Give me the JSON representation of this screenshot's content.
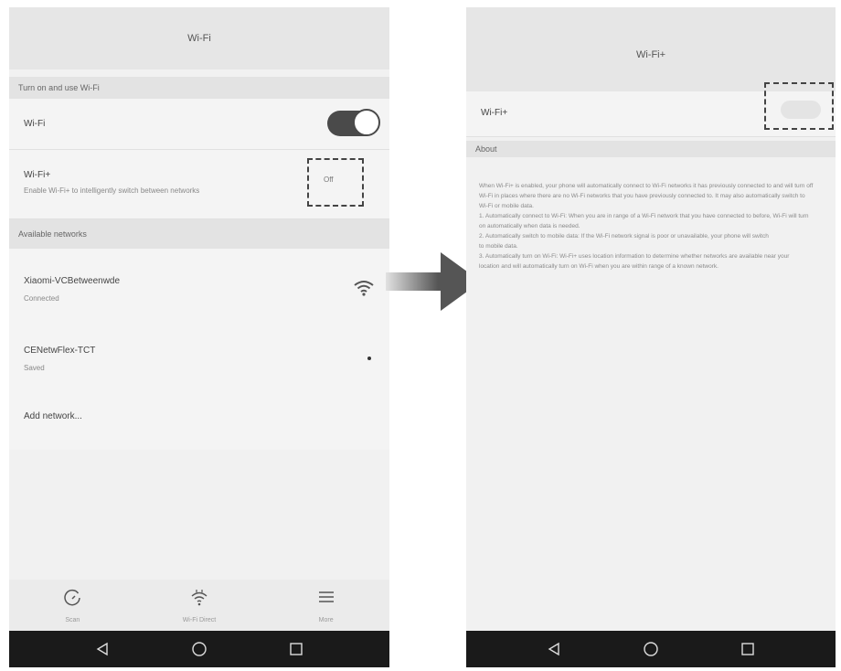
{
  "left_screen": {
    "title": "Wi-Fi",
    "top_section_label": "Turn on and use Wi-Fi",
    "wifi_row": {
      "label": "Wi-Fi",
      "toggle_on": true
    },
    "wifi_plus_row": {
      "label": "Wi-Fi+",
      "description": "Enable Wi-Fi+ to intelligently switch between networks",
      "status": "Off"
    },
    "available_networks_label": "Available networks",
    "networks": [
      {
        "name": "Xiaomi-VCBetweenwde",
        "status": "Connected",
        "icon": "wifi-signal-icon"
      },
      {
        "name": "CENetwFlex-TCT",
        "status": "Saved",
        "icon": "dot-icon"
      }
    ],
    "add_network_label": "Add network...",
    "bottom_tabs": [
      {
        "icon": "refresh-icon",
        "label": "Scan"
      },
      {
        "icon": "wifi-direct-icon",
        "label": "Wi-Fi Direct"
      },
      {
        "icon": "menu-icon",
        "label": "More"
      }
    ]
  },
  "right_screen": {
    "title": "Wi-Fi+",
    "wifi_plus_row": {
      "label": "Wi-Fi+",
      "toggle_on": false
    },
    "about_section_label": "About",
    "description_lines": [
      "When Wi-Fi+ is enabled, your phone will automatically connect to Wi-Fi networks it has previously connected to and will turn off",
      "Wi-Fi in places where there are no Wi-Fi networks that you have previously connected to. It may also automatically switch to",
      "Wi-Fi or mobile data.",
      "1. Automatically connect to Wi-Fi: When you are in range of a Wi-Fi network that you have connected to before, Wi-Fi will turn",
      "on automatically when data is needed.",
      "2. Automatically switch to mobile data: If the Wi-Fi network signal is poor or unavailable, your phone will switch",
      "to mobile data.",
      "3. Automatically turn on Wi-Fi: Wi-Fi+ uses location information to determine whether networks are available near your",
      "location and will automatically turn on Wi-Fi when you are within range of a known network."
    ]
  },
  "nav_buttons": [
    {
      "icon": "back-icon"
    },
    {
      "icon": "home-icon"
    },
    {
      "icon": "recents-icon"
    }
  ],
  "colors": {
    "toggle_on": "#4a4a4a",
    "nav_bar": "#1a1a1a",
    "arrow": "#555555"
  }
}
